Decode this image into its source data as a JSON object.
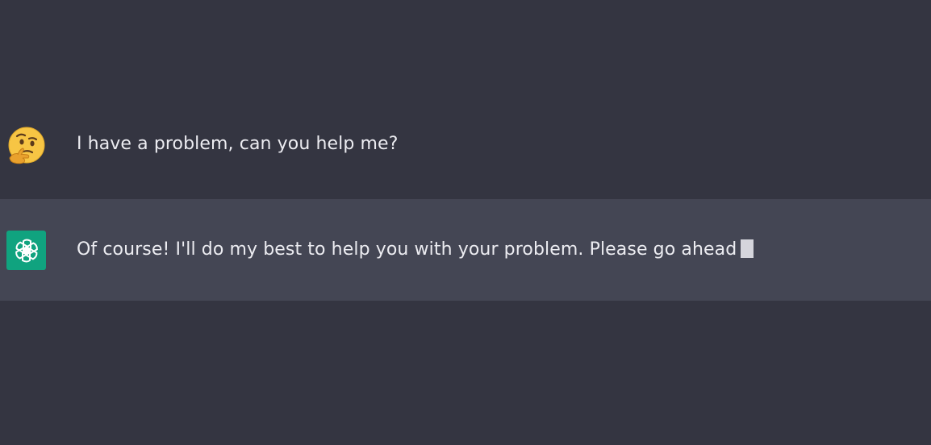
{
  "conversation": {
    "user_message": {
      "avatar_icon": "thinking-face-emoji",
      "text": "I have a problem, can you help me?"
    },
    "assistant_message": {
      "avatar_icon": "openai-logo-icon",
      "avatar_color": "#10a37f",
      "text": "Of course! I'll do my best to help you with your problem. Please go ahead"
    }
  },
  "colors": {
    "background": "#343541",
    "assistant_row": "#444654",
    "text": "#ececf1"
  }
}
